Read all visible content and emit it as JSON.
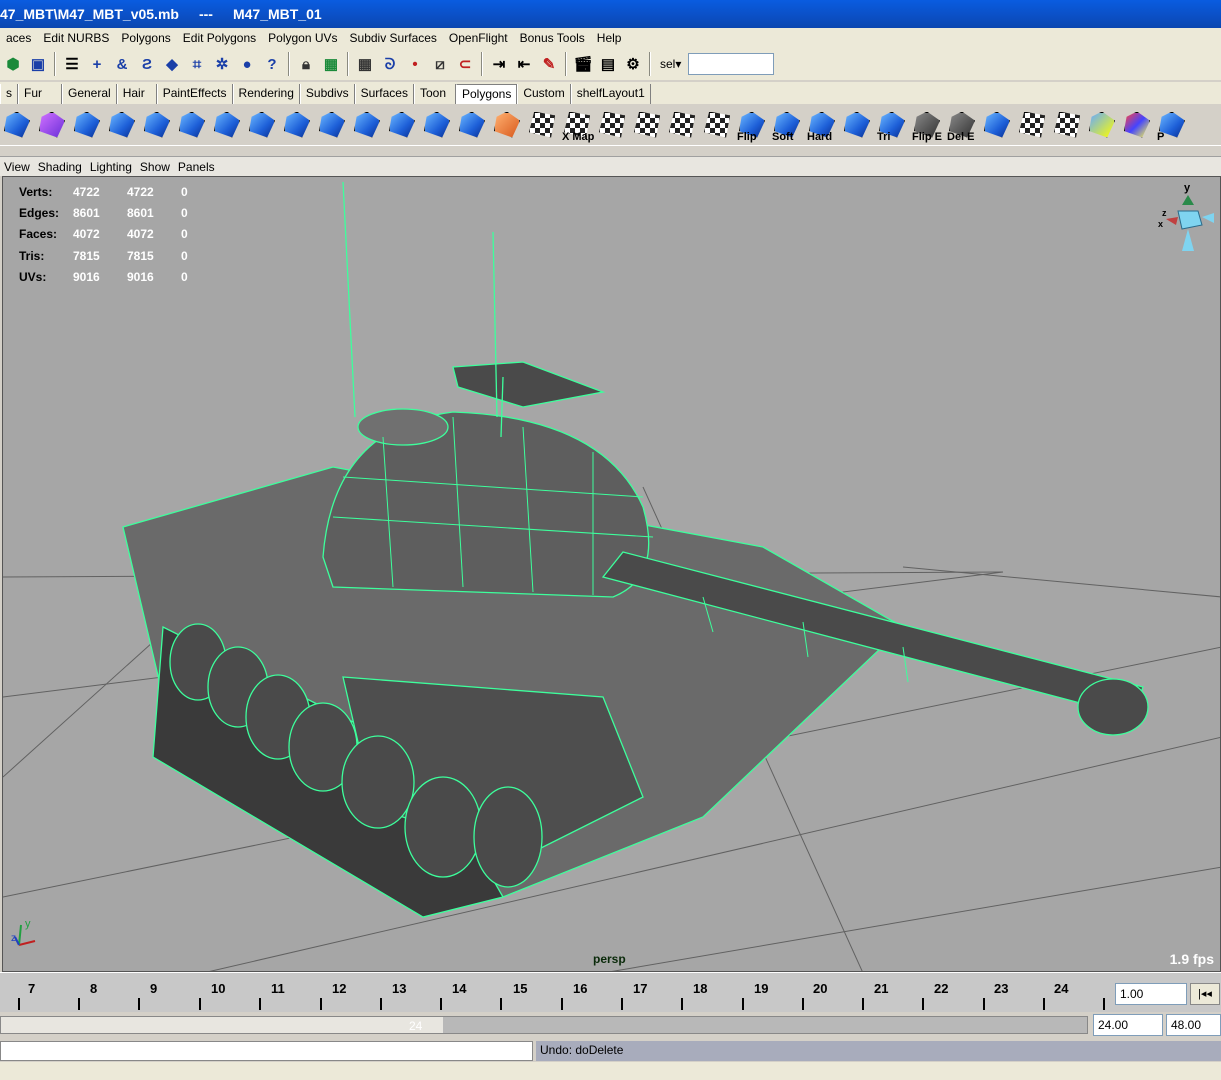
{
  "window": {
    "title_path": "47_MBT\\M47_MBT_v05.mb",
    "separator": "---",
    "scene_name": "M47_MBT_01"
  },
  "menubar": {
    "items": [
      "aces",
      "Edit NURBS",
      "Polygons",
      "Edit Polygons",
      "Polygon UVs",
      "Subdiv Surfaces",
      "OpenFlight",
      "Bonus Tools",
      "Help"
    ]
  },
  "statusline": {
    "sel_label": "sel▾",
    "sel_value": ""
  },
  "shelf": {
    "tabs": [
      "s",
      "Fur",
      "General",
      "Hair",
      "PaintEffects",
      "Rendering",
      "Subdivs",
      "Surfaces",
      "Toon",
      "Polygons",
      "Custom",
      "shelfLayout1"
    ],
    "active_tab": "Polygons",
    "icon_labels": [
      "X Map",
      "Flip",
      "Soft",
      "Hard",
      "Tri",
      "Flip E",
      "Del E",
      "P"
    ]
  },
  "panel": {
    "menu": [
      "View",
      "Shading",
      "Lighting",
      "Show",
      "Panels"
    ],
    "camera": "persp",
    "fps": "1.9 fps"
  },
  "hud": {
    "rows": [
      {
        "label": "Verts:",
        "a": "4722",
        "b": "4722",
        "c": "0"
      },
      {
        "label": "Edges:",
        "a": "8601",
        "b": "8601",
        "c": "0"
      },
      {
        "label": "Faces:",
        "a": "4072",
        "b": "4072",
        "c": "0"
      },
      {
        "label": "Tris:",
        "a": "7815",
        "b": "7815",
        "c": "0"
      },
      {
        "label": "UVs:",
        "a": "9016",
        "b": "9016",
        "c": "0"
      }
    ]
  },
  "axis": {
    "x": "x",
    "y": "y",
    "z": "z"
  },
  "timeline": {
    "ticks": [
      "7",
      "8",
      "9",
      "10",
      "11",
      "12",
      "13",
      "14",
      "15",
      "16",
      "17",
      "18",
      "19",
      "20",
      "21",
      "22",
      "23",
      "24"
    ],
    "current_time": "1.00",
    "step_label": "|◂◂"
  },
  "range": {
    "current_label": "24",
    "end_start": "24.00",
    "end_end": "48.00"
  },
  "command": {
    "input": "",
    "result": "Undo: doDelete"
  },
  "colors": {
    "wire": "#3dff9c",
    "viewport_bg": "#a6a6a6",
    "mesh_fill": "#5a5a5a",
    "title_bar": "#0a5ce0"
  }
}
